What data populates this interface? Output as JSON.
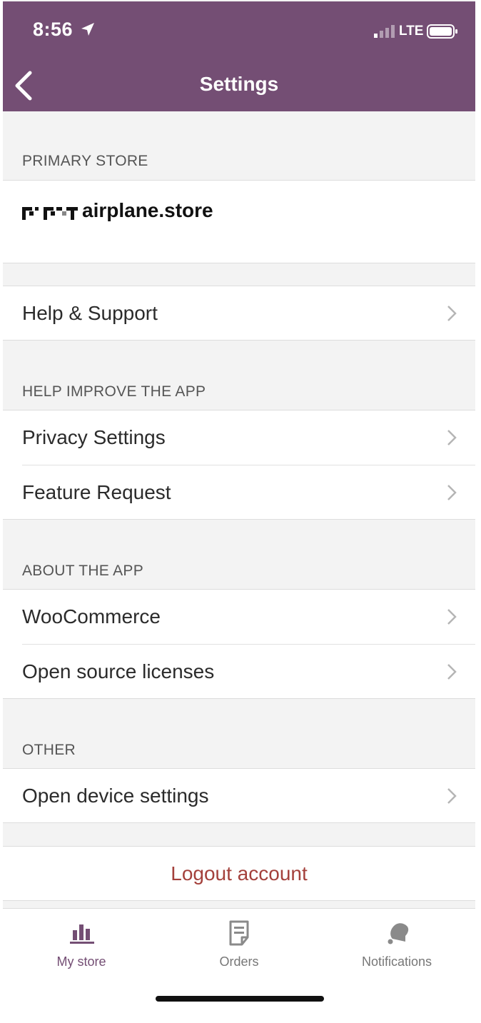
{
  "status_bar": {
    "time": "8:56",
    "carrier": "LTE"
  },
  "header": {
    "title": "Settings"
  },
  "primary_store": {
    "section": "PRIMARY STORE",
    "store_suffix": "airplane.store"
  },
  "help_support": {
    "label": "Help & Support"
  },
  "help_improve": {
    "section": "HELP IMPROVE THE APP",
    "items": [
      {
        "label": "Privacy Settings"
      },
      {
        "label": "Feature Request"
      }
    ]
  },
  "about": {
    "section": "ABOUT THE APP",
    "items": [
      {
        "label": "WooCommerce"
      },
      {
        "label": "Open source licenses"
      }
    ]
  },
  "other": {
    "section": "OTHER",
    "items": [
      {
        "label": "Open device settings"
      }
    ]
  },
  "logout": {
    "label": "Logout account"
  },
  "tabbar": {
    "tabs": [
      {
        "label": "My store",
        "icon": "bar-chart-icon",
        "active": true
      },
      {
        "label": "Orders",
        "icon": "document-icon",
        "active": false
      },
      {
        "label": "Notifications",
        "icon": "bell-icon",
        "active": false
      }
    ]
  },
  "colors": {
    "header": "#744e74",
    "accent": "#744e74",
    "logout": "#a4413c",
    "background": "#f3f3f3"
  }
}
